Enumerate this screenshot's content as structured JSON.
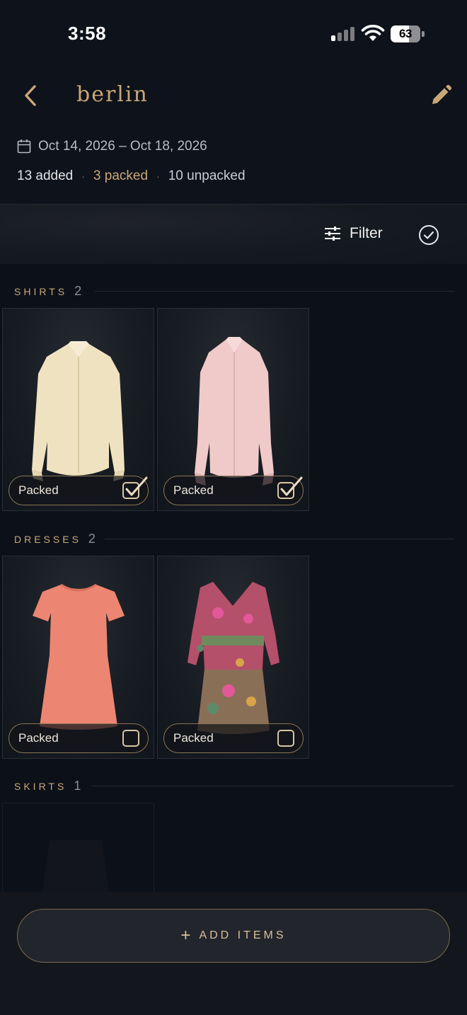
{
  "status_bar": {
    "time": "3:58",
    "battery": "63"
  },
  "header": {
    "title": "berlin"
  },
  "trip": {
    "dates": "Oct 14, 2026 – Oct 18, 2026",
    "added": "13 added",
    "packed": "3 packed",
    "unpacked": "10 unpacked",
    "separator": "·"
  },
  "toolbar": {
    "filter_label": "Filter"
  },
  "sections": [
    {
      "label": "SHIRTS",
      "count": "2",
      "items": [
        {
          "name": "Cream button-up shirt",
          "color": "#efe2c0",
          "packed_label": "Packed",
          "packed": true
        },
        {
          "name": "Pink button-up shirt",
          "color": "#f0c9c9",
          "packed_label": "Packed",
          "packed": true
        }
      ]
    },
    {
      "label": "DRESSES",
      "count": "2",
      "items": [
        {
          "name": "Coral t-shirt dress",
          "color": "#ec8571",
          "packed_label": "Packed",
          "packed": false
        },
        {
          "name": "Floral printed dress",
          "color": "#c8436a",
          "packed_label": "Packed",
          "packed": false
        }
      ]
    },
    {
      "label": "SKIRTS",
      "count": "1",
      "items": []
    }
  ],
  "footer": {
    "add_plus": "+",
    "add_label": "ADD ITEMS"
  },
  "colors": {
    "accent": "#c9a877",
    "background": "#0e121b"
  }
}
